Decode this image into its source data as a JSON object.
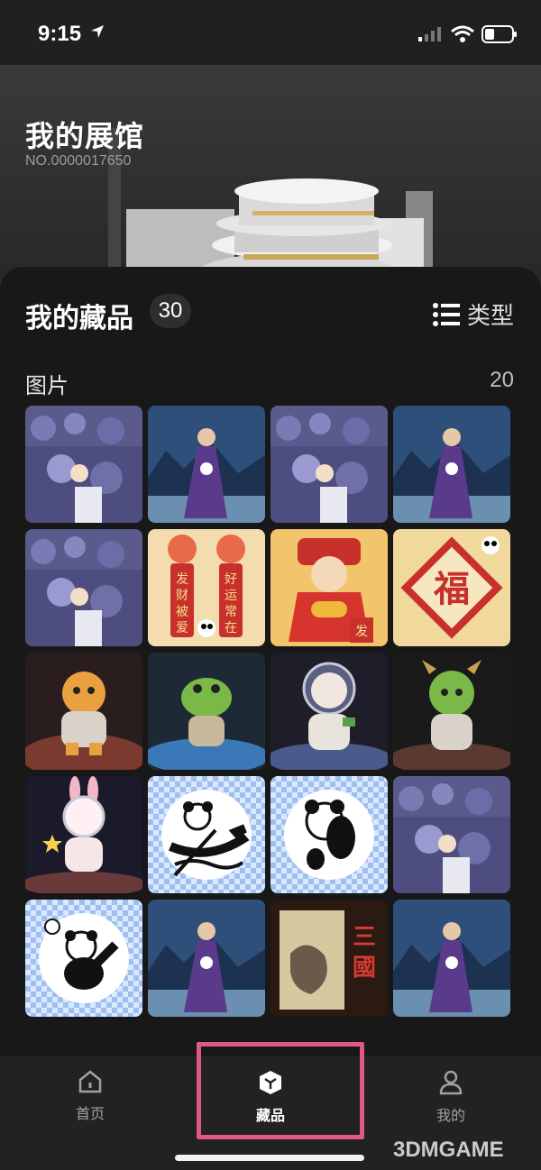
{
  "status_bar": {
    "time": "9:15"
  },
  "hero": {
    "title": "我的展馆",
    "number": "NO.0000017650"
  },
  "collection": {
    "title": "我的藏品",
    "count": "30",
    "type_label": "类型",
    "section": {
      "label": "图片",
      "count": "20"
    },
    "items": [
      {
        "kind": "crowd"
      },
      {
        "kind": "ninja"
      },
      {
        "kind": "crowd"
      },
      {
        "kind": "ninja"
      },
      {
        "kind": "crowd"
      },
      {
        "kind": "lion-couplet",
        "text": "发财被爱 好运常在"
      },
      {
        "kind": "fortune-god",
        "text": "发"
      },
      {
        "kind": "fu",
        "text": "福"
      },
      {
        "kind": "tiger"
      },
      {
        "kind": "frog"
      },
      {
        "kind": "sheep-astronaut"
      },
      {
        "kind": "dragon"
      },
      {
        "kind": "rabbit-astronaut"
      },
      {
        "kind": "panda-boat"
      },
      {
        "kind": "panda-yoga"
      },
      {
        "kind": "crowd"
      },
      {
        "kind": "panda-ball"
      },
      {
        "kind": "ninja"
      },
      {
        "kind": "three-kingdoms",
        "text": "三國"
      },
      {
        "kind": "ninja"
      }
    ]
  },
  "nav": {
    "home": "首页",
    "collection": "藏品",
    "mine": "我的"
  },
  "watermark": "3DMGAME",
  "colors": {
    "highlight": "#e0578a",
    "background": "#141414"
  }
}
